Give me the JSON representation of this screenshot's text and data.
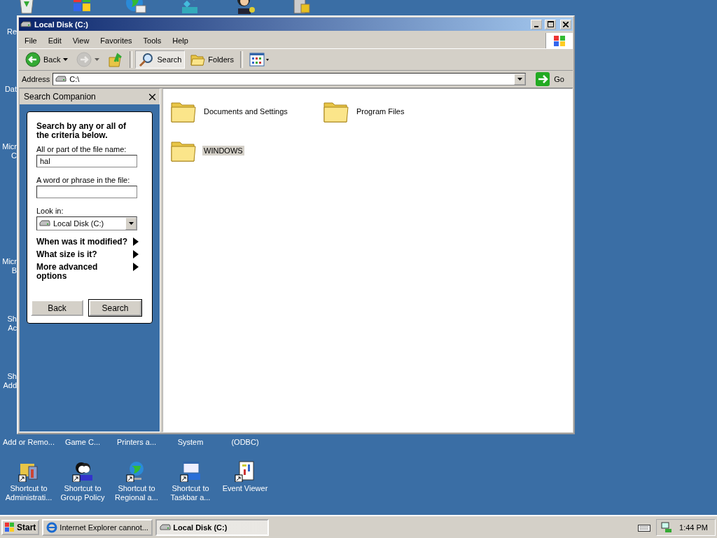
{
  "desktop": {
    "edge_labels": [
      {
        "lines": [
          "Re"
        ]
      },
      {
        "lines": [
          "Dat"
        ]
      },
      {
        "lines": [
          "Micr",
          "C"
        ]
      },
      {
        "lines": [
          "Micr",
          "B"
        ]
      },
      {
        "lines": [
          "Sh",
          "Ac"
        ]
      },
      {
        "lines": [
          "Sh",
          "Add"
        ]
      }
    ],
    "cut_labels": [
      "Add or Remo...",
      "Game C...",
      "Printers a...",
      "System",
      "(ODBC)"
    ],
    "icons": [
      {
        "kind": "admin",
        "lines": [
          "Shortcut to",
          "Administrati..."
        ]
      },
      {
        "kind": "people",
        "lines": [
          "Shortcut to",
          "Group Policy"
        ]
      },
      {
        "kind": "globe",
        "lines": [
          "Shortcut to",
          "Regional a..."
        ]
      },
      {
        "kind": "taskbar",
        "lines": [
          "Shortcut to",
          "Taskbar a..."
        ]
      },
      {
        "kind": "viewer",
        "lines": [
          "Event Viewer"
        ]
      }
    ]
  },
  "window": {
    "title": "Local Disk (C:)",
    "menu": [
      "File",
      "Edit",
      "View",
      "Favorites",
      "Tools",
      "Help"
    ],
    "toolbar": [
      {
        "kind": "back",
        "label": "Back",
        "disabled": false,
        "pressed": false
      },
      {
        "kind": "forward",
        "disabled": true,
        "pressed": false
      },
      {
        "kind": "up",
        "disabled": false,
        "pressed": false
      },
      {
        "kind": "search",
        "label": "Search",
        "disabled": false,
        "pressed": true
      },
      {
        "kind": "folders",
        "label": "Folders",
        "disabled": false,
        "pressed": false
      },
      {
        "kind": "views",
        "disabled": false,
        "pressed": false
      }
    ],
    "address": {
      "label": "Address",
      "value": "C:\\",
      "go": "Go"
    },
    "search_companion": {
      "title": "Search Companion",
      "heading": "Search by any or all of the criteria below.",
      "name_label": "All or part of the file name:",
      "name_value": "hal",
      "phrase_label": "A word or phrase in the file:",
      "look_in_label": "Look in:",
      "look_in_value": "Local Disk (C:)",
      "options": [
        "When was it modified?",
        "What size is it?",
        "More advanced options"
      ],
      "buttons": [
        {
          "label": "Back",
          "default": false
        },
        {
          "label": "Search",
          "default": true
        }
      ]
    },
    "folders": [
      {
        "name": "Documents and Settings",
        "selected": false
      },
      {
        "name": "Program Files",
        "selected": false
      },
      {
        "name": "WINDOWS",
        "selected": true
      }
    ]
  },
  "taskbar": {
    "start": "Start",
    "tasks": [
      {
        "kind": "browser",
        "label": "Internet Explorer cannot...",
        "selected": false
      },
      {
        "kind": "drive",
        "label": "Local Disk (C:)",
        "selected": true
      }
    ],
    "clock": "1:44 PM"
  }
}
